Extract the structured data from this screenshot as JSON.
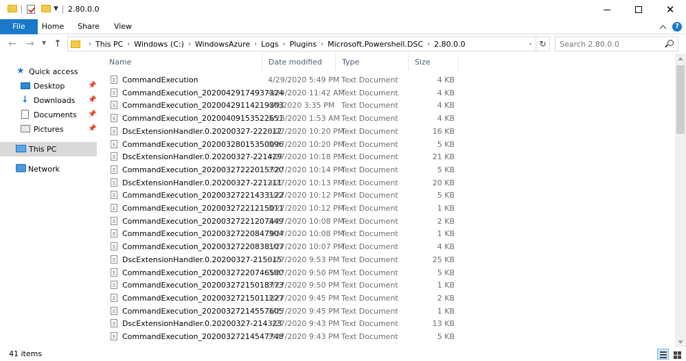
{
  "window": {
    "title": "2.80.0.0"
  },
  "ribbon": {
    "tabs": [
      {
        "label": "File"
      },
      {
        "label": "Home"
      },
      {
        "label": "Share"
      },
      {
        "label": "View"
      }
    ]
  },
  "address": {
    "crumbs": [
      "This PC",
      "Windows (C:)",
      "WindowsAzure",
      "Logs",
      "Plugins",
      "Microsoft.Powershell.DSC",
      "2.80.0.0"
    ]
  },
  "search": {
    "placeholder": "Search 2.80.0.0"
  },
  "navpane": {
    "quick_access": "Quick access",
    "items": [
      {
        "label": "Desktop"
      },
      {
        "label": "Downloads"
      },
      {
        "label": "Documents"
      },
      {
        "label": "Pictures"
      }
    ],
    "this_pc": "This PC",
    "network": "Network"
  },
  "columns": {
    "name": "Name",
    "date": "Date modified",
    "type": "Type",
    "size": "Size"
  },
  "files": [
    {
      "name": "CommandExecution",
      "date": "4/29/2020 5:49 PM",
      "type": "Text Document",
      "size": "4 KB"
    },
    {
      "name": "CommandExecution_20200429174937324",
      "date": "4/29/2020 11:42 AM",
      "type": "Text Document",
      "size": "4 KB"
    },
    {
      "name": "CommandExecution_20200429114219303",
      "date": "4/9/2020 3:35 PM",
      "type": "Text Document",
      "size": "4 KB"
    },
    {
      "name": "CommandExecution_20200409153522651",
      "date": "3/28/2020 1:53 AM",
      "type": "Text Document",
      "size": "4 KB"
    },
    {
      "name": "DscExtensionHandler.0.20200327-222012",
      "date": "3/27/2020 10:20 PM",
      "type": "Text Document",
      "size": "16 KB"
    },
    {
      "name": "CommandExecution_20200328015350096",
      "date": "3/27/2020 10:20 PM",
      "type": "Text Document",
      "size": "5 KB"
    },
    {
      "name": "DscExtensionHandler.0.20200327-221429",
      "date": "3/27/2020 10:18 PM",
      "type": "Text Document",
      "size": "21 KB"
    },
    {
      "name": "CommandExecution_20200327222015720",
      "date": "3/27/2020 10:14 PM",
      "type": "Text Document",
      "size": "5 KB"
    },
    {
      "name": "DscExtensionHandler.0.20200327-221211",
      "date": "3/27/2020 10:13 PM",
      "type": "Text Document",
      "size": "20 KB"
    },
    {
      "name": "CommandExecution_20200327221433122",
      "date": "3/27/2020 10:12 PM",
      "type": "Text Document",
      "size": "5 KB"
    },
    {
      "name": "CommandExecution_20200327221215011",
      "date": "3/27/2020 10:12 PM",
      "type": "Text Document",
      "size": "1 KB"
    },
    {
      "name": "CommandExecution_20200327221207449",
      "date": "3/27/2020 10:08 PM",
      "type": "Text Document",
      "size": "2 KB"
    },
    {
      "name": "CommandExecution_20200327220847904",
      "date": "3/27/2020 10:08 PM",
      "type": "Text Document",
      "size": "1 KB"
    },
    {
      "name": "CommandExecution_20200327220838107",
      "date": "3/27/2020 10:07 PM",
      "type": "Text Document",
      "size": "4 KB"
    },
    {
      "name": "DscExtensionHandler.0.20200327-215015",
      "date": "3/27/2020 9:53 PM",
      "type": "Text Document",
      "size": "25 KB"
    },
    {
      "name": "CommandExecution_20200327220746580",
      "date": "3/27/2020 9:50 PM",
      "type": "Text Document",
      "size": "5 KB"
    },
    {
      "name": "CommandExecution_20200327215018773",
      "date": "3/27/2020 9:50 PM",
      "type": "Text Document",
      "size": "1 KB"
    },
    {
      "name": "CommandExecution_20200327215011227",
      "date": "3/27/2020 9:45 PM",
      "type": "Text Document",
      "size": "2 KB"
    },
    {
      "name": "CommandExecution_20200327214557605",
      "date": "3/27/2020 9:45 PM",
      "type": "Text Document",
      "size": "1 KB"
    },
    {
      "name": "DscExtensionHandler.0.20200327-214323",
      "date": "3/27/2020 9:43 PM",
      "type": "Text Document",
      "size": "13 KB"
    },
    {
      "name": "CommandExecution_20200327214547748",
      "date": "3/27/2020 9:43 PM",
      "type": "Text Document",
      "size": "5 KB"
    }
  ],
  "status": {
    "item_count": "41 items"
  },
  "colors": {
    "accent": "#1979ca",
    "selection": "#cce8ff",
    "header_text": "#4c607a",
    "secondary_text": "#6d6d6d"
  }
}
